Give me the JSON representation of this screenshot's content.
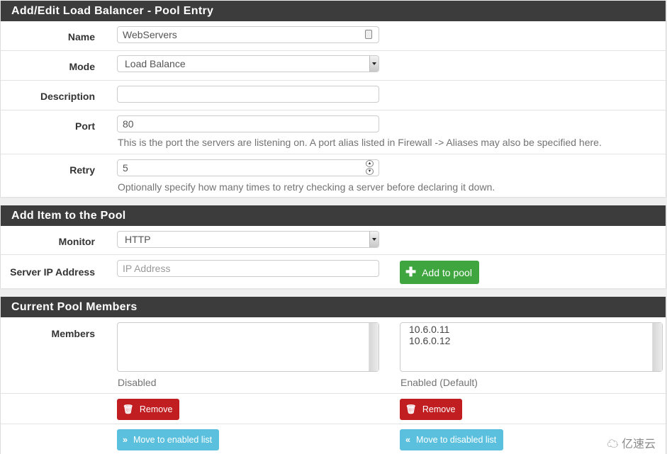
{
  "pool_entry": {
    "heading": "Add/Edit Load Balancer - Pool Entry",
    "name": {
      "label": "Name",
      "value": "WebServers",
      "icon": "contact-card-icon"
    },
    "mode": {
      "label": "Mode",
      "selected": "Load Balance"
    },
    "description": {
      "label": "Description",
      "value": ""
    },
    "port": {
      "label": "Port",
      "value": "80",
      "help": "This is the port the servers are listening on. A port alias listed in Firewall -> Aliases may also be specified here."
    },
    "retry": {
      "label": "Retry",
      "value": "5",
      "help": "Optionally specify how many times to retry checking a server before declaring it down."
    }
  },
  "add_item": {
    "heading": "Add Item to the Pool",
    "monitor": {
      "label": "Monitor",
      "selected": "HTTP"
    },
    "server_ip": {
      "label": "Server IP Address",
      "value": "",
      "placeholder": "IP Address"
    },
    "add_button": {
      "label": "Add to pool",
      "icon": "plus-icon",
      "color": "#3fa63f"
    }
  },
  "members": {
    "heading": "Current Pool Members",
    "label": "Members",
    "disabled_list": {
      "items": [],
      "caption": "Disabled"
    },
    "enabled_list": {
      "items": [
        "10.6.0.11",
        "10.6.0.12"
      ],
      "caption": "Enabled (Default)"
    },
    "remove_label": "Remove",
    "remove_color": "#c01e21",
    "move_enabled_label": "Move to enabled list",
    "move_disabled_label": "Move to disabled list",
    "move_color": "#5bc0de"
  },
  "watermark": "亿速云"
}
